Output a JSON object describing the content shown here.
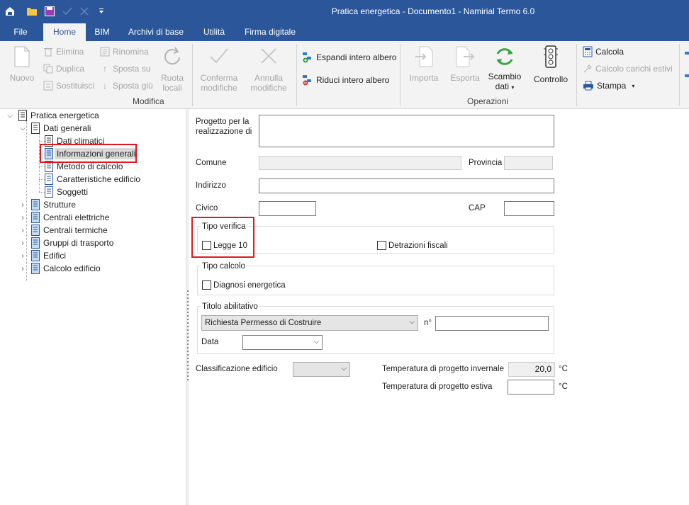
{
  "window": {
    "title": "Pratica energetica - Documento1 - Namirial Termo 6.0"
  },
  "quick_access": [
    {
      "name": "app-logo-icon"
    },
    {
      "name": "open-folder-icon"
    },
    {
      "name": "save-icon"
    },
    {
      "name": "checkmark-icon"
    },
    {
      "name": "close-icon"
    },
    {
      "name": "customize-dropdown-icon"
    }
  ],
  "ribbon_tabs": [
    "File",
    "Home",
    "BIM",
    "Archivi di base",
    "Utilità",
    "Firma digitale"
  ],
  "ribbon": {
    "modifica": {
      "label": "Modifica",
      "nuovo": "Nuovo",
      "elimina": "Elimina",
      "duplica": "Duplica",
      "sostituisci": "Sostituisci",
      "rinomina": "Rinomina",
      "sposta_su": "Sposta su",
      "sposta_giu": "Sposta giù",
      "ruota_locali": [
        "Ruota",
        "locali"
      ],
      "conferma": [
        "Conferma",
        "modifiche"
      ],
      "annulla": [
        "Annulla",
        "modifiche"
      ]
    },
    "albero": {
      "espandi": "Espandi intero albero",
      "riduci": "Riduci intero albero"
    },
    "operazioni": {
      "label": "Operazioni",
      "importa": "Importa",
      "esporta": "Esporta",
      "scambio": [
        "Scambio",
        "dati"
      ],
      "controllo": "Controllo"
    },
    "calcolo": {
      "calcola": "Calcola",
      "calcolo_carichi": "Calcolo carichi estivi",
      "stampa": "Stampa"
    }
  },
  "tree": {
    "root": "Pratica energetica",
    "dati_generali": "Dati generali",
    "children": [
      "Dati climatici",
      "Informazioni generali",
      "Metodo di calcolo",
      "Caratteristiche edificio",
      "Soggetti"
    ],
    "nodes": [
      "Strutture",
      "Centrali elettriche",
      "Centrali termiche",
      "Gruppi di trasporto",
      "Edifici",
      "Calcolo edificio"
    ]
  },
  "form": {
    "progetto_label": [
      "Progetto per la",
      "realizzazione di"
    ],
    "progetto_value": "",
    "comune_label": "Comune",
    "comune_value": "",
    "provincia_label": "Provincia",
    "provincia_value": "",
    "indirizzo_label": "Indirizzo",
    "indirizzo_value": "",
    "civico_label": "Civico",
    "civico_value": "",
    "cap_label": "CAP",
    "cap_value": "",
    "tipo_verifica": {
      "legend": "Tipo verifica",
      "legge10": "Legge 10",
      "detrazioni": "Detrazioni fiscali"
    },
    "tipo_calcolo": {
      "legend": "Tipo calcolo",
      "diagnosi": "Diagnosi energetica"
    },
    "titolo": {
      "legend": "Titolo abilitativo",
      "selected": "Richiesta Permesso di Costruire",
      "numero_label": "n°",
      "numero_value": "",
      "data_label": "Data",
      "data_value": ""
    },
    "classificazione_label": "Classificazione edificio",
    "classificazione_value": "",
    "temp_invernale_label": "Temperatura di progetto invernale",
    "temp_invernale_value": "20,0",
    "temp_estiva_label": "Temperatura di progetto estiva",
    "temp_estiva_value": "",
    "unit": "°C"
  },
  "colors": {
    "accent": "#2b579a",
    "highlight": "#e0191e"
  }
}
